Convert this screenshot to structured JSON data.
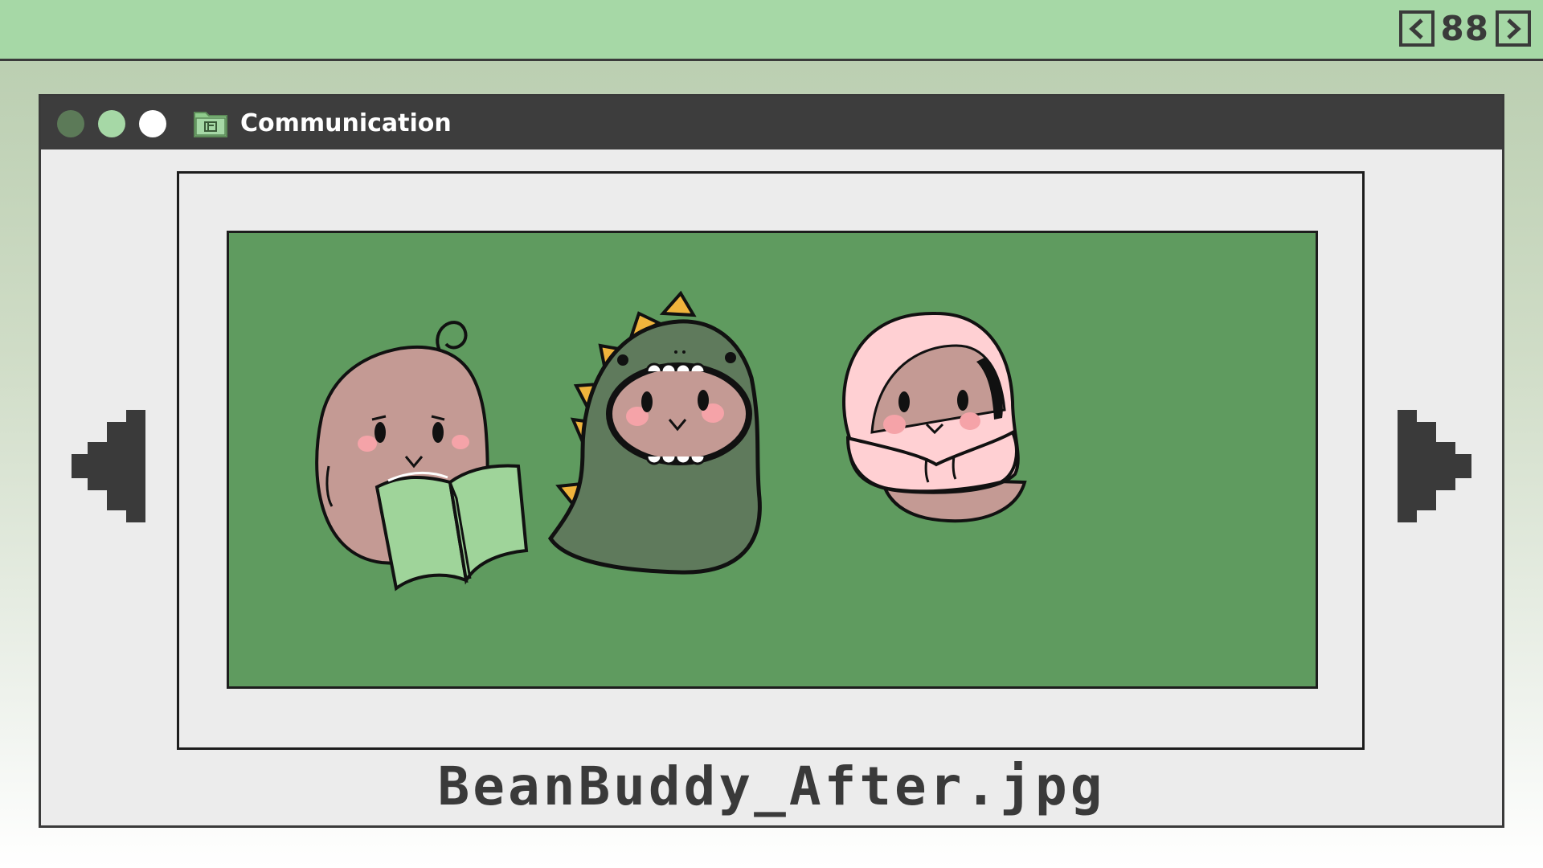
{
  "pager": {
    "prev_icon": "chevron-left-icon",
    "page_number": "88",
    "next_icon": "chevron-right-icon"
  },
  "window": {
    "title": "Communication",
    "folder_icon": "folder-icon",
    "control_colors": [
      "#5c7a58",
      "#a6d8a6",
      "#ffffff"
    ]
  },
  "viewer": {
    "filename": "BeanBuddy_After.jpg",
    "prev_icon": "pixel-arrow-left-icon",
    "next_icon": "pixel-arrow-right-icon",
    "image_subjects": [
      "bean-reading-book",
      "bean-in-dinosaur-costume",
      "bean-in-pink-hoodie"
    ]
  },
  "colors": {
    "top_bar": "#a6d8a6",
    "title_bar": "#3d3d3d",
    "image_background": "#5f9b5f",
    "bean": "#c49a94",
    "dino": "#5f7a5c",
    "dino_spikes": "#f0b43c",
    "hoodie": "#ffd0d3",
    "book": "#9fd49a"
  }
}
